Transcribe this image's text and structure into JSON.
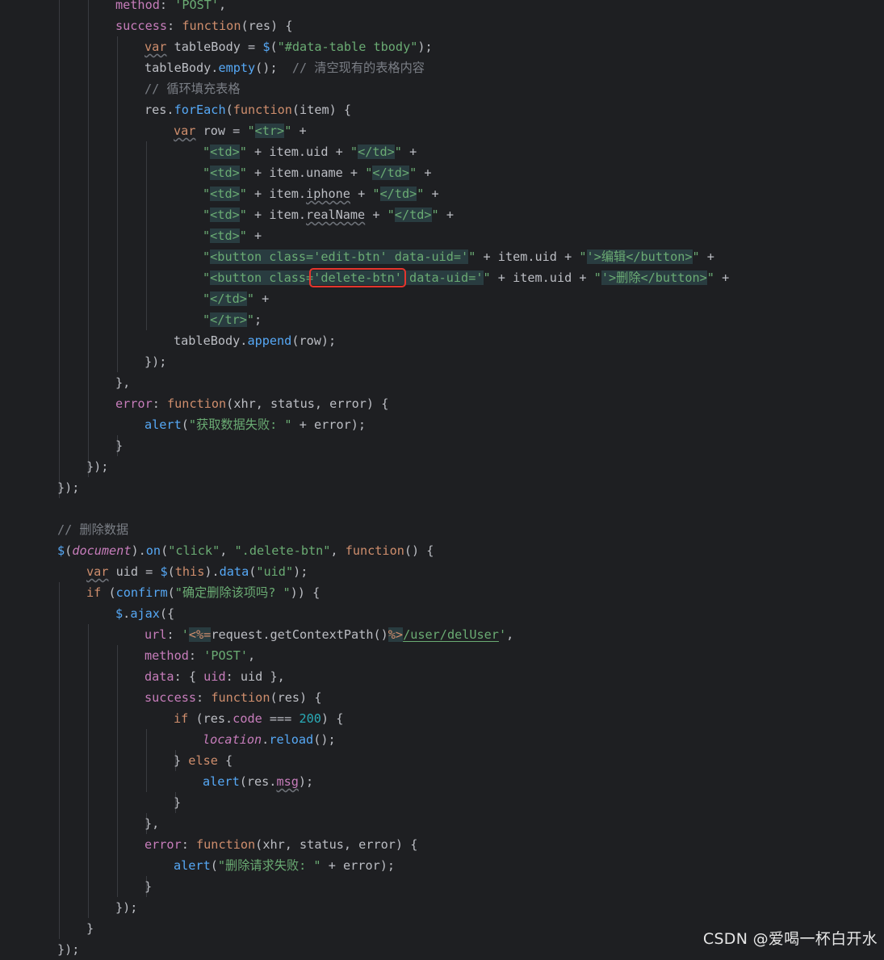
{
  "colors": {
    "background": "#1e1f22",
    "text": "#bcbec4",
    "keyword": "#cf8e6d",
    "string": "#6aab73",
    "property": "#c77dbb",
    "method": "#56a8f5",
    "number": "#2aacb8",
    "comment": "#7a7e85",
    "param": "#c77dbb",
    "html_string_bg": "#293c40",
    "highlight_border": "#e5352d"
  },
  "code_lines": [
    [
      {
        "t": "method",
        "c": "p"
      },
      {
        "t": ": ",
        "c": "d"
      },
      {
        "t": "'POST'",
        "c": "s"
      },
      {
        "t": ",",
        "c": "d"
      }
    ],
    [
      {
        "t": "success",
        "c": "p"
      },
      {
        "t": ": ",
        "c": "d"
      },
      {
        "t": "function",
        "c": "k"
      },
      {
        "t": "(res) {",
        "c": "d"
      }
    ],
    [
      {
        "t": "var",
        "c": "k",
        "u": 1
      },
      {
        "t": " tableBody = ",
        "c": "d"
      },
      {
        "t": "$",
        "c": "m"
      },
      {
        "t": "(",
        "c": "d"
      },
      {
        "t": "\"#data-table tbody\"",
        "c": "s"
      },
      {
        "t": ");",
        "c": "d"
      }
    ],
    [
      {
        "t": "tableBody.",
        "c": "d"
      },
      {
        "t": "empty",
        "c": "m"
      },
      {
        "t": "();  ",
        "c": "d"
      },
      {
        "t": "// 清空现有的表格内容",
        "c": "c"
      }
    ],
    [
      {
        "t": "// 循环填充表格",
        "c": "c"
      }
    ],
    [
      {
        "t": "res.",
        "c": "d"
      },
      {
        "t": "forEach",
        "c": "m"
      },
      {
        "t": "(",
        "c": "d"
      },
      {
        "t": "function",
        "c": "k"
      },
      {
        "t": "(item) {",
        "c": "d"
      }
    ],
    [
      {
        "t": "var",
        "c": "k",
        "u": 1
      },
      {
        "t": " row = ",
        "c": "d"
      },
      {
        "t": "\"",
        "c": "s"
      },
      {
        "t": "<tr>",
        "c": "h"
      },
      {
        "t": "\"",
        "c": "s"
      },
      {
        "t": " +",
        "c": "d"
      }
    ],
    [
      {
        "t": "\"",
        "c": "s"
      },
      {
        "t": "<td>",
        "c": "h"
      },
      {
        "t": "\"",
        "c": "s"
      },
      {
        "t": " + item.uid + ",
        "c": "d"
      },
      {
        "t": "\"",
        "c": "s"
      },
      {
        "t": "</td>",
        "c": "h"
      },
      {
        "t": "\"",
        "c": "s"
      },
      {
        "t": " +",
        "c": "d"
      }
    ],
    [
      {
        "t": "\"",
        "c": "s"
      },
      {
        "t": "<td>",
        "c": "h"
      },
      {
        "t": "\"",
        "c": "s"
      },
      {
        "t": " + item.uname + ",
        "c": "d"
      },
      {
        "t": "\"",
        "c": "s"
      },
      {
        "t": "</td>",
        "c": "h"
      },
      {
        "t": "\"",
        "c": "s"
      },
      {
        "t": " +",
        "c": "d"
      }
    ],
    [
      {
        "t": "\"",
        "c": "s"
      },
      {
        "t": "<td>",
        "c": "h"
      },
      {
        "t": "\"",
        "c": "s"
      },
      {
        "t": " + item.",
        "c": "d"
      },
      {
        "t": "iphone",
        "c": "d",
        "u": 1
      },
      {
        "t": " + ",
        "c": "d"
      },
      {
        "t": "\"",
        "c": "s"
      },
      {
        "t": "</td>",
        "c": "h"
      },
      {
        "t": "\"",
        "c": "s"
      },
      {
        "t": " +",
        "c": "d"
      }
    ],
    [
      {
        "t": "\"",
        "c": "s"
      },
      {
        "t": "<td>",
        "c": "h"
      },
      {
        "t": "\"",
        "c": "s"
      },
      {
        "t": " + item.",
        "c": "d"
      },
      {
        "t": "realName",
        "c": "d",
        "u": 1
      },
      {
        "t": " + ",
        "c": "d"
      },
      {
        "t": "\"",
        "c": "s"
      },
      {
        "t": "</td>",
        "c": "h"
      },
      {
        "t": "\"",
        "c": "s"
      },
      {
        "t": " +",
        "c": "d"
      }
    ],
    [
      {
        "t": "\"",
        "c": "s"
      },
      {
        "t": "<td>",
        "c": "h"
      },
      {
        "t": "\"",
        "c": "s"
      },
      {
        "t": " +",
        "c": "d"
      }
    ],
    [
      {
        "t": "\"",
        "c": "s"
      },
      {
        "t": "<button class=",
        "c": "h"
      },
      {
        "t": "'edit-btn'",
        "c": "hs"
      },
      {
        "t": " data-uid=",
        "c": "h"
      },
      {
        "t": "'",
        "c": "hs"
      },
      {
        "t": "\"",
        "c": "s"
      },
      {
        "t": " + item.uid + ",
        "c": "d"
      },
      {
        "t": "\"",
        "c": "s"
      },
      {
        "t": "'",
        "c": "hs"
      },
      {
        "t": ">编辑</button>",
        "c": "h"
      },
      {
        "t": "\"",
        "c": "s"
      },
      {
        "t": " +",
        "c": "d"
      }
    ],
    [
      {
        "t": "\"",
        "c": "s"
      },
      {
        "t": "<button class=",
        "c": "h"
      },
      {
        "t": "'delete-btn'",
        "c": "hs"
      },
      {
        "t": " data-uid=",
        "c": "h"
      },
      {
        "t": "'",
        "c": "hs"
      },
      {
        "t": "\"",
        "c": "s"
      },
      {
        "t": " + item.uid + ",
        "c": "d"
      },
      {
        "t": "\"",
        "c": "s"
      },
      {
        "t": "'",
        "c": "hs"
      },
      {
        "t": ">删除</button>",
        "c": "h"
      },
      {
        "t": "\"",
        "c": "s"
      },
      {
        "t": " +",
        "c": "d"
      }
    ],
    [
      {
        "t": "\"",
        "c": "s"
      },
      {
        "t": "</td>",
        "c": "h"
      },
      {
        "t": "\"",
        "c": "s"
      },
      {
        "t": " +",
        "c": "d"
      }
    ],
    [
      {
        "t": "\"",
        "c": "s"
      },
      {
        "t": "</tr>",
        "c": "h"
      },
      {
        "t": "\"",
        "c": "s"
      },
      {
        "t": ";",
        "c": "d"
      }
    ],
    [
      {
        "t": "tableBody.",
        "c": "d"
      },
      {
        "t": "append",
        "c": "m"
      },
      {
        "t": "(row);",
        "c": "d"
      }
    ],
    [
      {
        "t": "});",
        "c": "d"
      }
    ],
    [
      {
        "t": "},",
        "c": "d"
      }
    ],
    [
      {
        "t": "error",
        "c": "p"
      },
      {
        "t": ": ",
        "c": "d"
      },
      {
        "t": "function",
        "c": "k"
      },
      {
        "t": "(xhr, status, error) {",
        "c": "d"
      }
    ],
    [
      {
        "t": "alert",
        "c": "m"
      },
      {
        "t": "(",
        "c": "d"
      },
      {
        "t": "\"获取数据失败: \"",
        "c": "s"
      },
      {
        "t": " + error);",
        "c": "d"
      }
    ],
    [
      {
        "t": "}",
        "c": "d"
      }
    ],
    [
      {
        "t": "});",
        "c": "d"
      }
    ],
    [
      {
        "t": "});",
        "c": "d"
      }
    ],
    [],
    [
      {
        "t": "// 删除数据",
        "c": "c"
      }
    ],
    [
      {
        "t": "$",
        "c": "m"
      },
      {
        "t": "(",
        "c": "d"
      },
      {
        "t": "document",
        "c": "p",
        "i": 1
      },
      {
        "t": ").",
        "c": "d"
      },
      {
        "t": "on",
        "c": "m"
      },
      {
        "t": "(",
        "c": "d"
      },
      {
        "t": "\"click\"",
        "c": "s"
      },
      {
        "t": ", ",
        "c": "d"
      },
      {
        "t": "\".delete-btn\"",
        "c": "s"
      },
      {
        "t": ", ",
        "c": "d"
      },
      {
        "t": "function",
        "c": "k"
      },
      {
        "t": "() {",
        "c": "d"
      }
    ],
    [
      {
        "t": "var",
        "c": "k",
        "u": 1
      },
      {
        "t": " uid = ",
        "c": "d"
      },
      {
        "t": "$",
        "c": "m"
      },
      {
        "t": "(",
        "c": "d"
      },
      {
        "t": "this",
        "c": "k"
      },
      {
        "t": ").",
        "c": "d"
      },
      {
        "t": "data",
        "c": "m"
      },
      {
        "t": "(",
        "c": "d"
      },
      {
        "t": "\"uid\"",
        "c": "s"
      },
      {
        "t": ");",
        "c": "d"
      }
    ],
    [
      {
        "t": "if",
        "c": "k"
      },
      {
        "t": " (",
        "c": "d"
      },
      {
        "t": "confirm",
        "c": "m"
      },
      {
        "t": "(",
        "c": "d"
      },
      {
        "t": "\"确定删除该项吗? \"",
        "c": "s"
      },
      {
        "t": ")) {",
        "c": "d"
      }
    ],
    [
      {
        "t": "$",
        "c": "m"
      },
      {
        "t": ".",
        "c": "d"
      },
      {
        "t": "ajax",
        "c": "m"
      },
      {
        "t": "({",
        "c": "d"
      }
    ],
    [
      {
        "t": "url",
        "c": "p"
      },
      {
        "t": ": ",
        "c": "d"
      },
      {
        "t": "'",
        "c": "s"
      },
      {
        "t": "<%=",
        "c": "jt"
      },
      {
        "t": "request.getContextPath()",
        "c": "d"
      },
      {
        "t": "%>",
        "c": "jt"
      },
      {
        "t": "/user/delUser",
        "c": "s",
        "u": 2
      },
      {
        "t": "'",
        "c": "s"
      },
      {
        "t": ",",
        "c": "d"
      }
    ],
    [
      {
        "t": "method",
        "c": "p"
      },
      {
        "t": ": ",
        "c": "d"
      },
      {
        "t": "'POST'",
        "c": "s"
      },
      {
        "t": ",",
        "c": "d"
      }
    ],
    [
      {
        "t": "data",
        "c": "p"
      },
      {
        "t": ": { ",
        "c": "d"
      },
      {
        "t": "uid",
        "c": "p"
      },
      {
        "t": ": uid },",
        "c": "d"
      }
    ],
    [
      {
        "t": "success",
        "c": "p"
      },
      {
        "t": ": ",
        "c": "d"
      },
      {
        "t": "function",
        "c": "k"
      },
      {
        "t": "(res) {",
        "c": "d"
      }
    ],
    [
      {
        "t": "if",
        "c": "k"
      },
      {
        "t": " (res.",
        "c": "d"
      },
      {
        "t": "code",
        "c": "p"
      },
      {
        "t": " === ",
        "c": "d"
      },
      {
        "t": "200",
        "c": "n"
      },
      {
        "t": ") {",
        "c": "d"
      }
    ],
    [
      {
        "t": "location",
        "c": "p",
        "i": 1
      },
      {
        "t": ".",
        "c": "d"
      },
      {
        "t": "reload",
        "c": "m"
      },
      {
        "t": "();",
        "c": "d"
      }
    ],
    [
      {
        "t": "} ",
        "c": "d"
      },
      {
        "t": "else",
        "c": "k"
      },
      {
        "t": " {",
        "c": "d"
      }
    ],
    [
      {
        "t": "alert",
        "c": "m"
      },
      {
        "t": "(res.",
        "c": "d"
      },
      {
        "t": "msg",
        "c": "p",
        "u": 1
      },
      {
        "t": ");",
        "c": "d"
      }
    ],
    [
      {
        "t": "}",
        "c": "d"
      }
    ],
    [
      {
        "t": "},",
        "c": "d"
      }
    ],
    [
      {
        "t": "error",
        "c": "p"
      },
      {
        "t": ": ",
        "c": "d"
      },
      {
        "t": "function",
        "c": "k"
      },
      {
        "t": "(xhr, status, error) {",
        "c": "d"
      }
    ],
    [
      {
        "t": "alert",
        "c": "m"
      },
      {
        "t": "(",
        "c": "d"
      },
      {
        "t": "\"删除请求失败: \"",
        "c": "s"
      },
      {
        "t": " + error);",
        "c": "d"
      }
    ],
    [
      {
        "t": "}",
        "c": "d"
      }
    ],
    [
      {
        "t": "});",
        "c": "d"
      }
    ],
    [
      {
        "t": "}",
        "c": "d"
      }
    ],
    [
      {
        "t": "});",
        "c": "d"
      }
    ]
  ],
  "watermark": "CSDN @爱喝一杯白开水"
}
